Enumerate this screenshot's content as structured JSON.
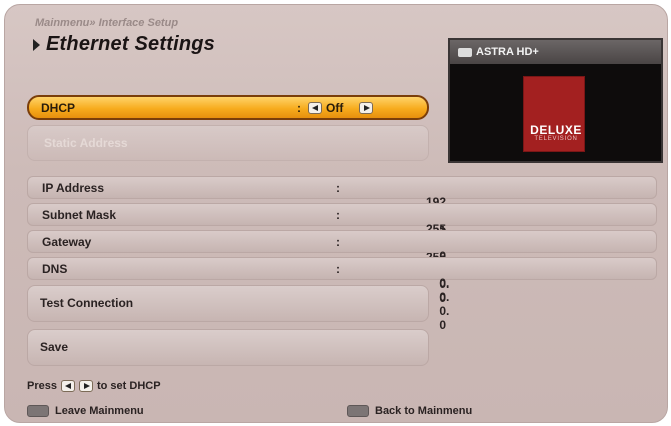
{
  "header": {
    "breadcrumb": "Mainmenu» Interface Setup",
    "title": "Ethernet Settings"
  },
  "preview": {
    "channel": "ASTRA HD+",
    "logo_text": "DELUXE",
    "logo_sub": "TELEVISION"
  },
  "dhcp": {
    "label": "DHCP",
    "colon": ":",
    "value": "Off"
  },
  "ip_mode": {
    "label": "Static Address"
  },
  "network": {
    "colon": ":",
    "rows": [
      {
        "label": "IP Address",
        "octets": [
          "192",
          "168",
          "1",
          "15"
        ]
      },
      {
        "label": "Subnet Mask",
        "octets": [
          "255",
          "255",
          "255",
          "0"
        ]
      },
      {
        "label": "Gateway",
        "octets": [
          "0",
          "0",
          "0",
          "0"
        ]
      },
      {
        "label": "DNS",
        "octets": [
          "0",
          "0",
          "0",
          "0"
        ]
      }
    ]
  },
  "actions": {
    "test_connection": "Test Connection",
    "save": "Save"
  },
  "hint": {
    "prefix": "Press",
    "suffix": "to set DHCP"
  },
  "footer": {
    "leave": "Leave Mainmenu",
    "back": "Back to Mainmenu"
  }
}
